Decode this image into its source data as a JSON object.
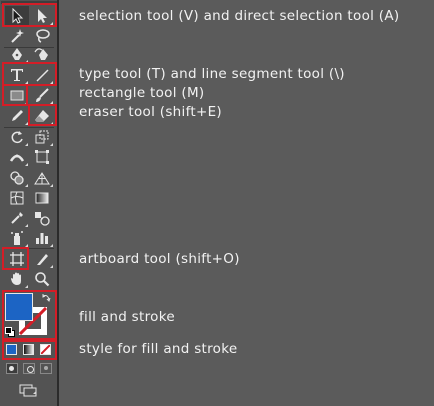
{
  "annotations": {
    "selection": "selection tool (V) and direct selection tool (A)",
    "type_line": "type tool (T) and line segment tool (\\)",
    "rectangle": "rectangle tool (M)",
    "eraser": "eraser tool (shift+E)",
    "artboard": "artboard tool (shift+O)",
    "fill_stroke": "fill and stroke",
    "style": "style for fill and stroke"
  },
  "tools": [
    "selection-tool",
    "direct-selection-tool",
    "magic-wand-tool",
    "lasso-tool",
    "pen-tool",
    "curvature-tool",
    "type-tool",
    "line-segment-tool",
    "rectangle-tool",
    "paintbrush-tool",
    "pencil-tool",
    "eraser-tool",
    "rotate-tool",
    "scale-tool",
    "width-tool",
    "free-transform-tool",
    "shape-builder-tool",
    "perspective-grid-tool",
    "mesh-tool",
    "gradient-tool",
    "eyedropper-tool",
    "blend-tool",
    "symbol-sprayer-tool",
    "column-graph-tool",
    "artboard-tool",
    "slice-tool",
    "hand-tool",
    "zoom-tool"
  ],
  "colors": {
    "fill": "#1c64c4",
    "stroke": "#ffffff",
    "accent": "#d41d27",
    "panel": "#535353"
  }
}
